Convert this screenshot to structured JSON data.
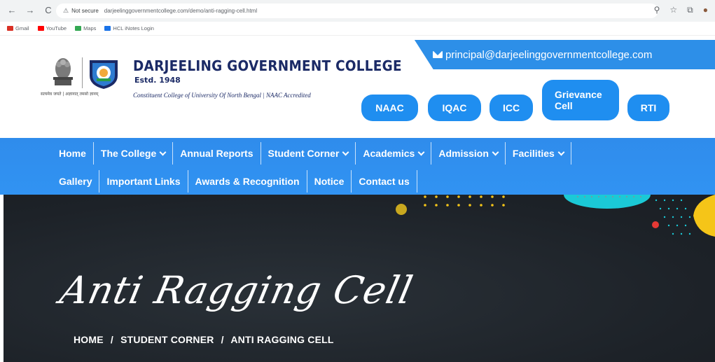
{
  "browser": {
    "nav": [
      "←",
      "→",
      "C"
    ],
    "security": "Not secure",
    "url": "darjeelinggovernmentcollege.com/demo/anti-ragging-cell.html",
    "right_icons": [
      "zoom-icon",
      "star-icon",
      "extensions-icon",
      "profile-icon"
    ]
  },
  "bookmarks": [
    {
      "label": "Gmail",
      "color": "#d93025"
    },
    {
      "label": "YouTube",
      "color": "#ff0000"
    },
    {
      "label": "Maps",
      "color": "#34a853"
    },
    {
      "label": "HCL iNotes Login",
      "color": "#1a73e8"
    }
  ],
  "header": {
    "hindi_motto": "सत्यमेव जयते | अज्ञानात् तमसो ज्ञानम्",
    "college_name": "DARJEELING GOVERNMENT COLLEGE",
    "estd": "Estd. 1948",
    "constituent": "Constituent College of University Of North Bengal  |  NAAC Accredited",
    "email": "principal@darjeelinggovernmentcollege.com",
    "quick_links": {
      "naac": "NAAC",
      "iqac": "IQAC",
      "icc": "ICC",
      "grievance_line1": "Grievance",
      "grievance_line2": "Cell",
      "rti": "RTI"
    }
  },
  "nav": {
    "row1": {
      "home": "Home",
      "college": "The College",
      "annual": "Annual Reports",
      "student": "Student Corner",
      "academics": "Academics",
      "admission": "Admission",
      "facilities": "Facilities"
    },
    "row2": {
      "gallery": "Gallery",
      "links": "Important Links",
      "awards": "Awards & Recognition",
      "notice": "Notice",
      "contact": "Contact us"
    }
  },
  "hero": {
    "title": "Anti Ragging Cell",
    "breadcrumb": {
      "home": "HOME",
      "sep": "/",
      "student": "STUDENT CORNER",
      "current": "ANTI RAGGING CELL"
    }
  },
  "colors": {
    "brand_blue": "#2d8fe8",
    "navy": "#1b2a66",
    "hero_dark": "#1d2228",
    "accent_cyan": "#1bc9d6",
    "accent_yellow": "#f5c518",
    "accent_red": "#e53935"
  }
}
